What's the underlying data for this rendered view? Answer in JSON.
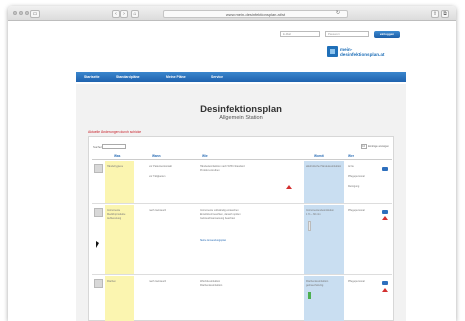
{
  "browser": {
    "url": "www.mein-desinfektionsplan.at/st",
    "back": "‹",
    "forward": "›"
  },
  "header": {
    "login_field_1": "E-Mail",
    "login_field_2": "Passwort",
    "login_button": "einloggen",
    "logo_text_line1": "mein-",
    "logo_text_line2": "desinfektionsplan.at"
  },
  "nav": {
    "items": [
      "Startseite",
      "Standardpläne",
      "Meine Pläne",
      "Service"
    ]
  },
  "main": {
    "title": "Desinfektionsplan",
    "subtitle": "Allgemein Station",
    "changes_link": "Aktuelle Änderungen durch schicke",
    "search_label": "Suchen:",
    "perpage_value": "10",
    "perpage_label": "Einträge anzeigen",
    "columns": [
      "Was",
      "Wann",
      "Wie",
      "Womit",
      "Wer"
    ],
    "rows": [
      {
        "was": "Händehygiene",
        "wann": "vor Patientenkontakt",
        "wann2": "vor Tätigkeiten",
        "wie": "Händedesinfektion nach WHO-Standard",
        "wie2": "Produkt einreiben",
        "womit": "alkoholische Händedesinfektion",
        "wer": "Ärzte",
        "wer2": "Pflegepersonal",
        "wer3": "Reinigung"
      },
      {
        "was": "Instrumente",
        "was2": "Medizinprodukte",
        "was3": "Aufbereitung",
        "wann": "nach Gebrauch",
        "wie": "Instrumente vollständig eintauchen",
        "wie2": "Einwirkzeit beachten, danach spülen",
        "wie3": "Gebrauchsanweisung beachten",
        "wie4": "Siehe Anwendungsplan",
        "womit": "Instrumentendesinfektion",
        "womit2": "1 % – 60 min",
        "wer": "Pflegepersonal"
      },
      {
        "was": "Flächen",
        "wann": "nach Gebrauch",
        "wie": "Wischdesinfektion",
        "wie2": "Flächendesinfektion",
        "womit": "Flächendesinfektion",
        "womit2": "gebrauchsfertig",
        "wer": "Pflegepersonal"
      }
    ]
  },
  "colors": {
    "nav_blue": "#1f62ae",
    "was_highlight": "#fbf5b0",
    "womit_highlight": "#c9def1",
    "alert_red": "#c8202a"
  }
}
